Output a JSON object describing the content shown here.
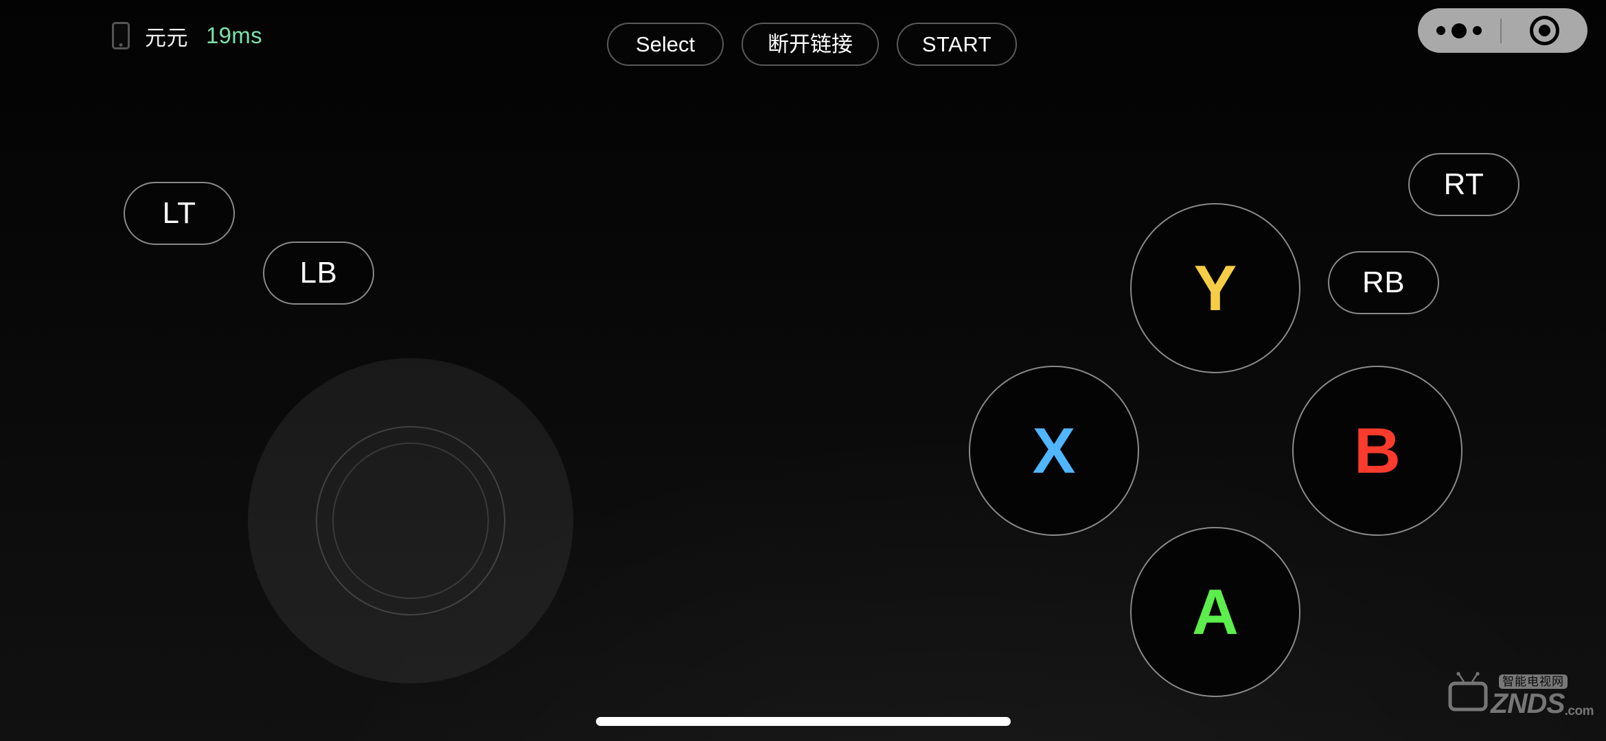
{
  "app": {
    "title": "Virtual Gamepad Controller",
    "background_color": "#050505"
  },
  "status_bar": {
    "device_icon": "mobile-phone-icon",
    "device_name": "元元",
    "latency": "19ms",
    "latency_color": "#7ce3ab"
  },
  "system_buttons": [
    {
      "id": "select",
      "label": "Select"
    },
    {
      "id": "disconnect",
      "label": "断开链接"
    },
    {
      "id": "start",
      "label": "START"
    }
  ],
  "assistive_pill": {
    "dots_icon": "more-dots-icon",
    "record_icon": "record-target-icon",
    "background_color": "#a9a9a9"
  },
  "shoulder_buttons": [
    {
      "id": "lt",
      "label": "LT"
    },
    {
      "id": "lb",
      "label": "LB"
    },
    {
      "id": "rt",
      "label": "RT"
    },
    {
      "id": "rb",
      "label": "RB"
    }
  ],
  "face_buttons": [
    {
      "id": "y",
      "label": "Y",
      "color": "#f7cd46"
    },
    {
      "id": "x",
      "label": "X",
      "color": "#4fb6ff"
    },
    {
      "id": "b",
      "label": "B",
      "color": "#fc3b2d"
    },
    {
      "id": "a",
      "label": "A",
      "color": "#5cee4c"
    }
  ],
  "joystick": {
    "name": "left-analog-stick",
    "label": ""
  },
  "home_indicator": {
    "label": ""
  },
  "watermark": {
    "cn_text": "智能电视网",
    "brand": "ZNDS",
    "suffix": ".com",
    "icon": "tv-icon"
  }
}
